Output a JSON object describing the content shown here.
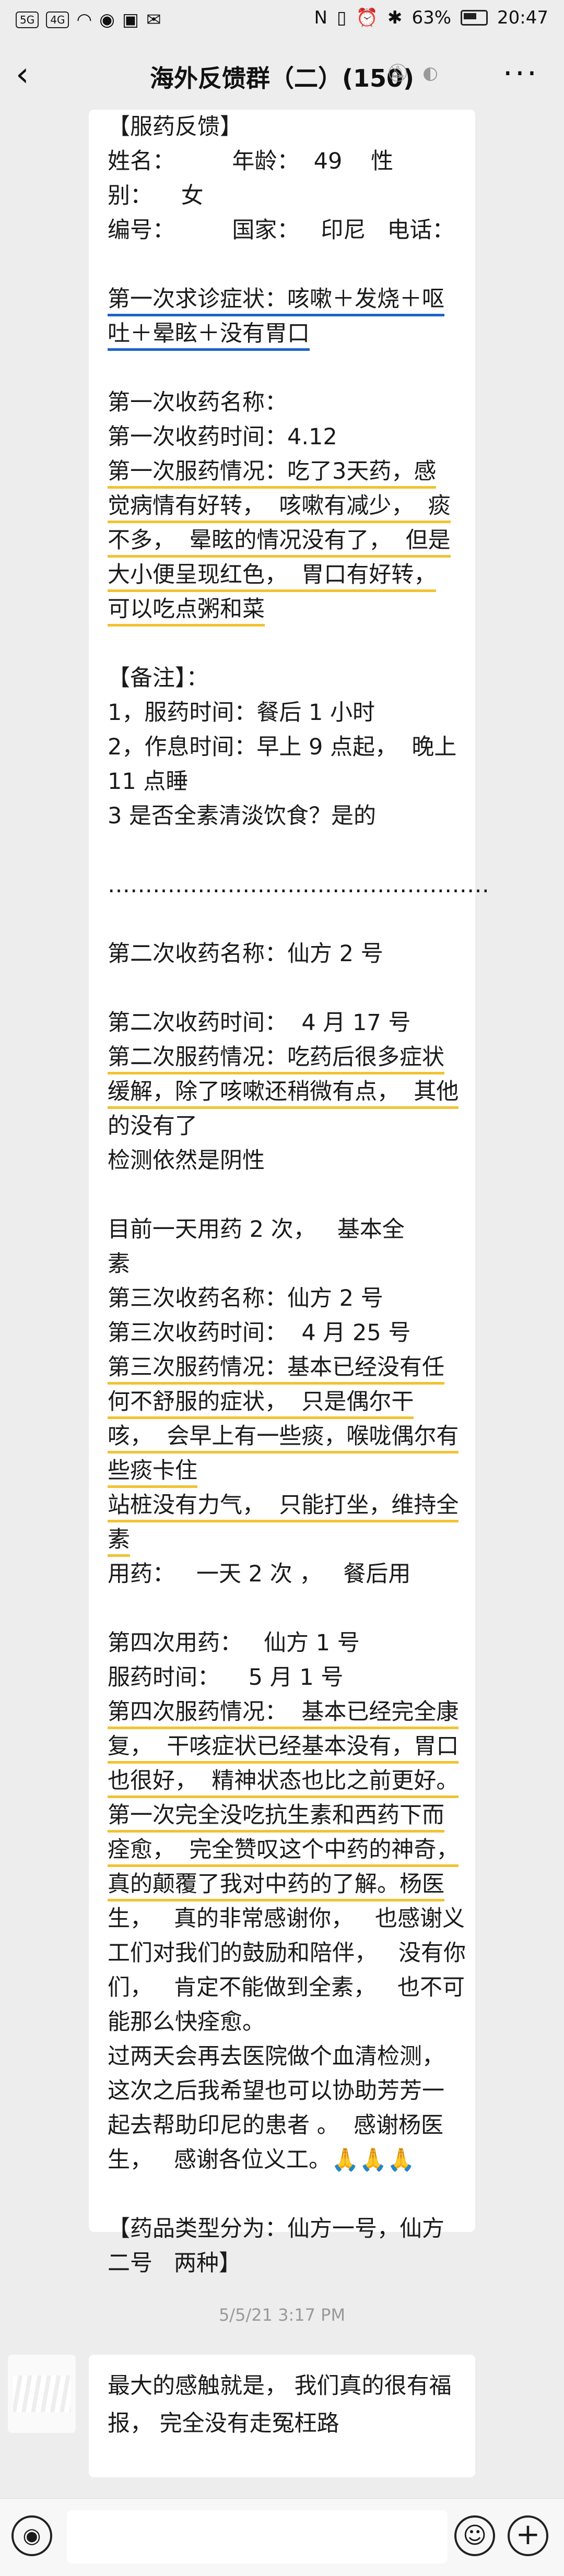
{
  "status_bar": {
    "left_chips": [
      "5G",
      "4G"
    ],
    "battery": "63%",
    "time": "20:47"
  },
  "header": {
    "title": "海外反馈群（二）(150)"
  },
  "message": {
    "lines": [
      {
        "text": "【服药反馈】"
      },
      {
        "text": "姓名：        年龄：  49    性",
        "mask": true
      },
      {
        "text": "别：    女"
      },
      {
        "text": "编号：        国家：   印尼   电话："
      },
      {
        "text": ""
      },
      {
        "text": "第一次求诊症状：咳嗽＋发烧＋呕",
        "ul": "b"
      },
      {
        "text": "吐＋晕眩＋没有胃口",
        "ul": "b"
      },
      {
        "text": ""
      },
      {
        "text": "第一次收药名称："
      },
      {
        "text": "第一次收药时间：4.12"
      },
      {
        "text": "第一次服药情况：吃了3天药，感",
        "ul": "y"
      },
      {
        "text": "觉病情有好转，  咳嗽有减少，  痰",
        "ul": "y"
      },
      {
        "text": "不多，  晕眩的情况没有了，  但是",
        "ul": "y"
      },
      {
        "text": "大小便呈现红色，  胃口有好转，",
        "ul": "y"
      },
      {
        "text": "可以吃点粥和菜",
        "ul": "y"
      },
      {
        "text": ""
      },
      {
        "text": "【备注】："
      },
      {
        "text": "1，服药时间：餐后 1 小时"
      },
      {
        "text": "2，作息时间：早上 9 点起，  晚上"
      },
      {
        "text": "11 点睡"
      },
      {
        "text": "3 是否全素清淡饮食？是的"
      },
      {
        "text": ""
      },
      {
        "text": "……………………………………………"
      },
      {
        "text": ""
      },
      {
        "text": "第二次收药名称：仙方 2 号"
      },
      {
        "text": ""
      },
      {
        "text": "第二次收药时间：  4 月 17 号"
      },
      {
        "text": "第二次服药情况：吃药后很多症状",
        "ul": "y"
      },
      {
        "text": "缓解，除了咳嗽还稍微有点，  其他",
        "ul": "y"
      },
      {
        "text": "的没有了"
      },
      {
        "text": "检测依然是阴性"
      },
      {
        "text": ""
      },
      {
        "text": "目前一天用药 2 次，   基本全"
      },
      {
        "text": "素"
      },
      {
        "text": "第三次收药名称：仙方 2 号"
      },
      {
        "text": "第三次收药时间：  4 月 25 号"
      },
      {
        "text": "第三次服药情况：基本已经没有任",
        "ul": "y"
      },
      {
        "text": "何不舒服的症状，  只是偶尔干",
        "ul": "y"
      },
      {
        "text": "咳，  会早上有一些痰，喉咙偶尔有",
        "ul": "y"
      },
      {
        "text": "些痰卡住",
        "ul": "y"
      },
      {
        "text": "站桩没有力气，  只能打坐，维持全",
        "ul": "y"
      },
      {
        "text": "素",
        "ul": "y"
      },
      {
        "text": "用药：   一天 2 次 ，   餐后用"
      },
      {
        "text": ""
      },
      {
        "text": "第四次用药：   仙方 1 号"
      },
      {
        "text": "服药时间：    5 月 1 号"
      },
      {
        "text": "第四次服药情况：  基本已经完全康",
        "ul": "y"
      },
      {
        "text": "复，  干咳症状已经基本没有，胃口",
        "ul": "y"
      },
      {
        "text": "也很好，  精神状态也比之前更好。",
        "ul": "y"
      },
      {
        "text": "第一次完全没吃抗生素和西药下而",
        "ul": "y"
      },
      {
        "text": "痊愈，  完全赞叹这个中药的神奇，",
        "ul": "y"
      },
      {
        "text": "真的颠覆了我对中药的了解。杨医",
        "ul": "y"
      },
      {
        "text": "生，   真的非常感谢你，   也感谢义"
      },
      {
        "text": "工们对我们的鼓励和陪伴，   没有你"
      },
      {
        "text": "们，   肯定不能做到全素，   也不可"
      },
      {
        "text": "能那么快痊愈。"
      },
      {
        "text": "过两天会再去医院做个血清检测，"
      },
      {
        "text": "这次之后我希望也可以协助芳芳一"
      },
      {
        "text": "起去帮助印尼的患者 。  感谢杨医"
      },
      {
        "text": "生，   感谢各位义工。🙏🙏🙏"
      },
      {
        "text": ""
      },
      {
        "text": "【药品类型分为：仙方一号，仙方"
      },
      {
        "text": "二号   两种】"
      }
    ]
  },
  "timestamp": "5/5/21 3:17 PM",
  "message2": {
    "line1": "最大的感触就是，  我们真的很有福",
    "line2": "报，  完全没有走冤枉路"
  },
  "input": {
    "placeholder": ""
  }
}
